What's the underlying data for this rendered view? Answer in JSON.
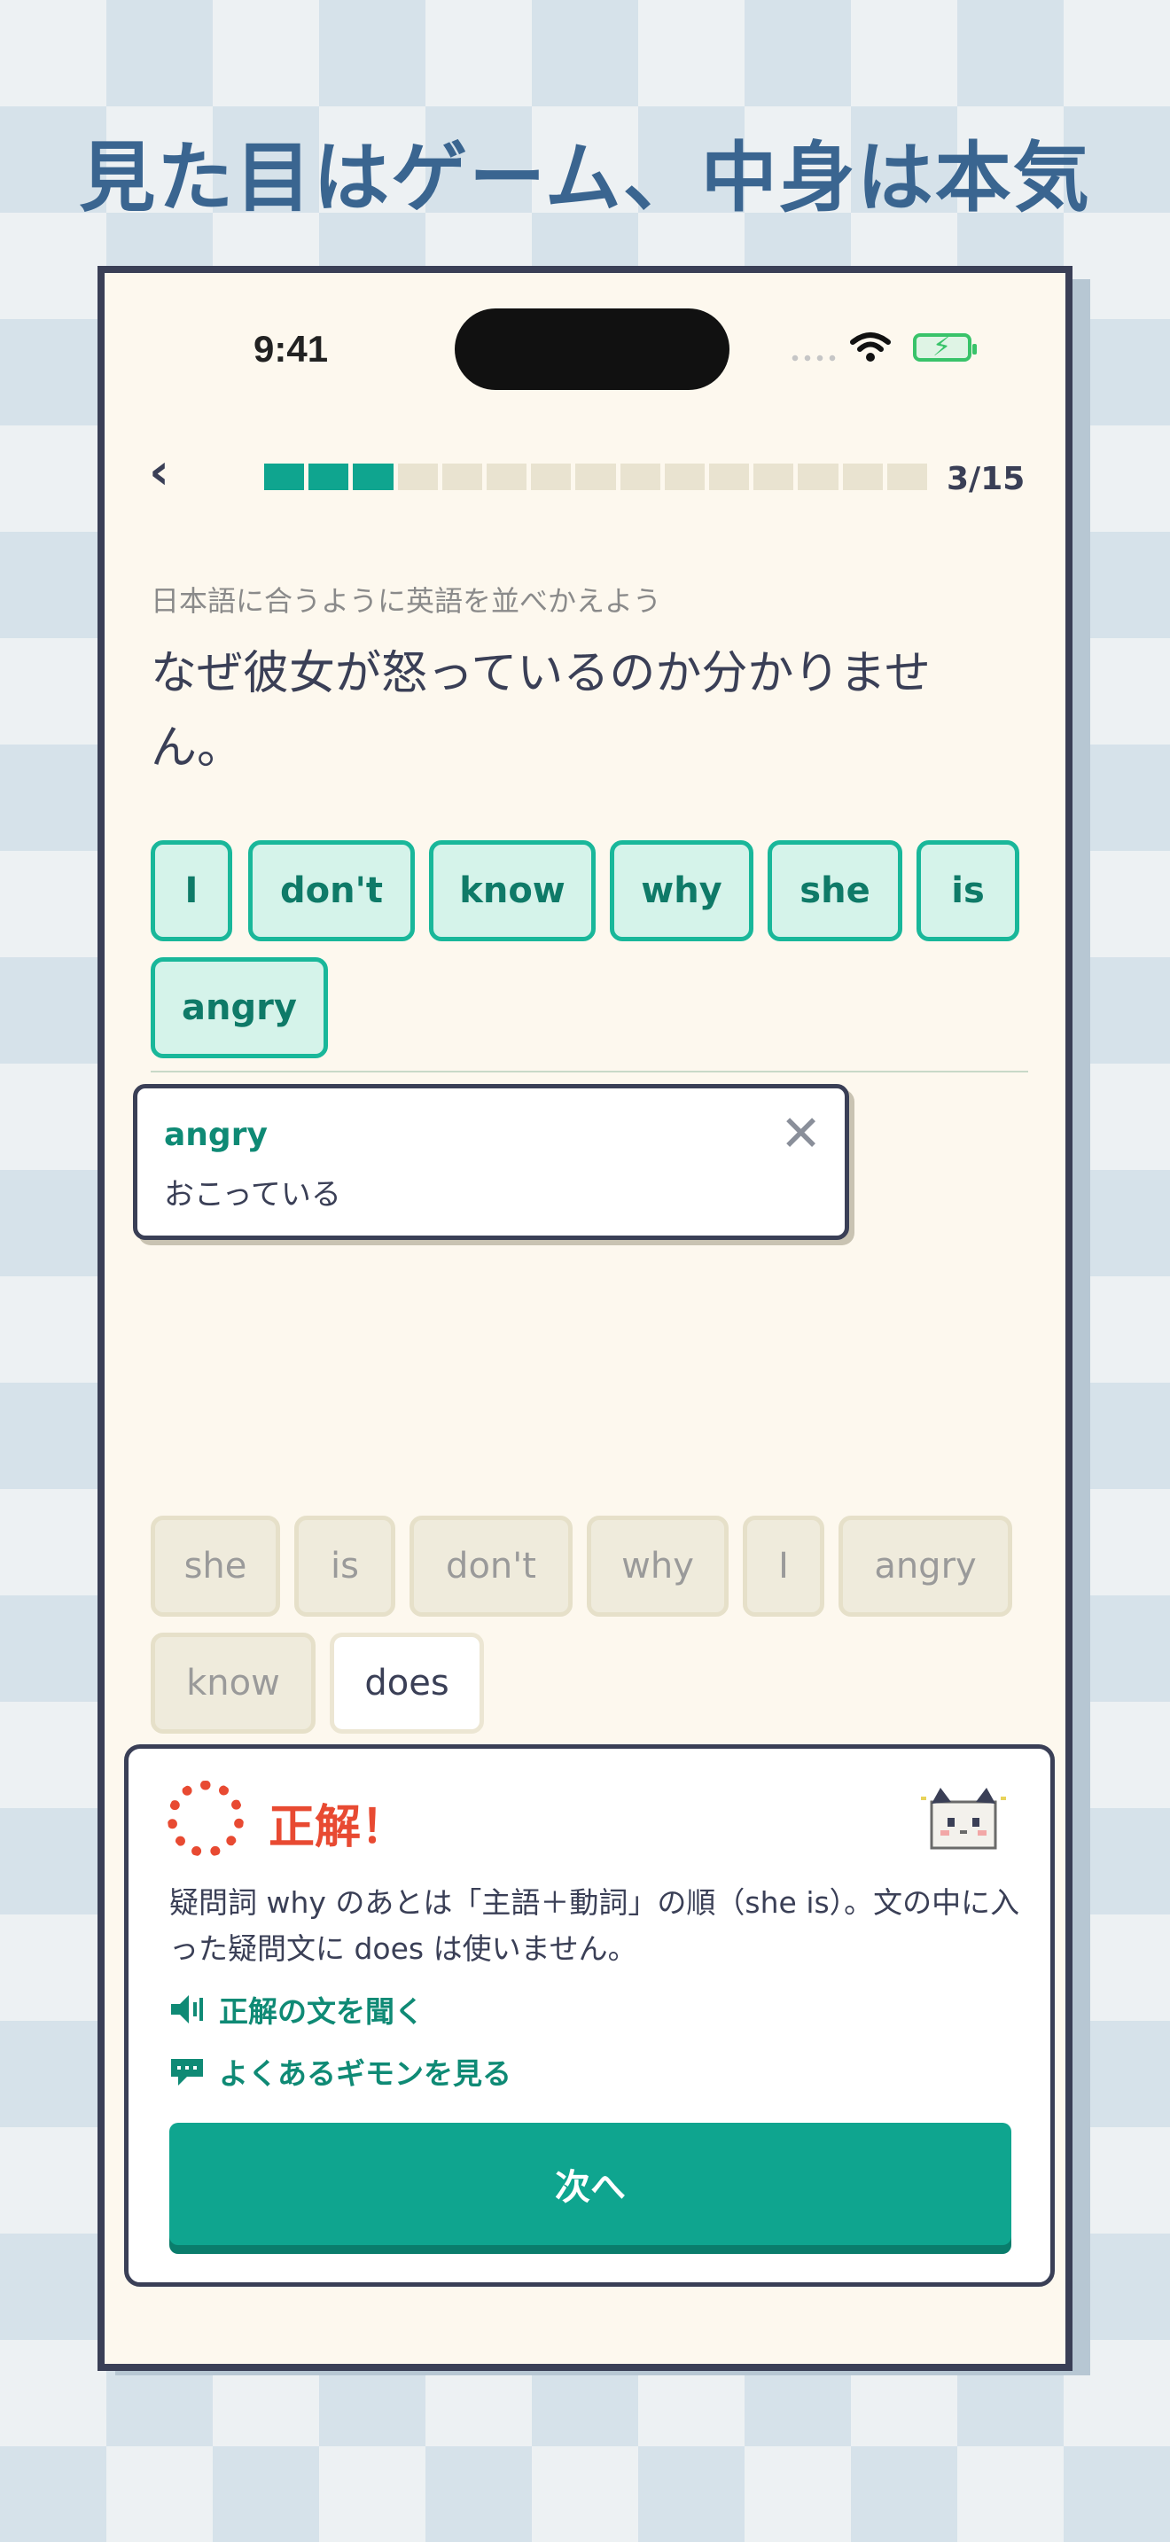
{
  "headline": "見た目はゲーム、中身は本気",
  "status_bar": {
    "time": "9:41"
  },
  "progress": {
    "current": 3,
    "total": 15,
    "label": "3/15"
  },
  "instruction": "日本語に合うように英語を並べかえよう",
  "question": "なぜ彼女が怒っているのか分かりません。",
  "answer_chips": [
    "I",
    "don't",
    "know",
    "why",
    "she",
    "is",
    "angry"
  ],
  "tooltip": {
    "word": "angry",
    "meaning": "おこっている"
  },
  "word_bank": [
    {
      "label": "she",
      "used": true
    },
    {
      "label": "is",
      "used": true
    },
    {
      "label": "don't",
      "used": true
    },
    {
      "label": "why",
      "used": true
    },
    {
      "label": "I",
      "used": true
    },
    {
      "label": "angry",
      "used": true
    },
    {
      "label": "know",
      "used": true
    },
    {
      "label": "does",
      "used": false
    }
  ],
  "result": {
    "title": "正解！",
    "explanation": "疑問詞 why のあとは「主語＋動詞」の順（she is）。文の中に入った疑問文に does は使いません。",
    "link_listen": "正解の文を聞く",
    "link_faq": "よくあるギモンを見る",
    "next_label": "次へ"
  },
  "colors": {
    "accent": "#0fa58f",
    "correct": "#e84a32",
    "ink": "#3a3f56"
  }
}
